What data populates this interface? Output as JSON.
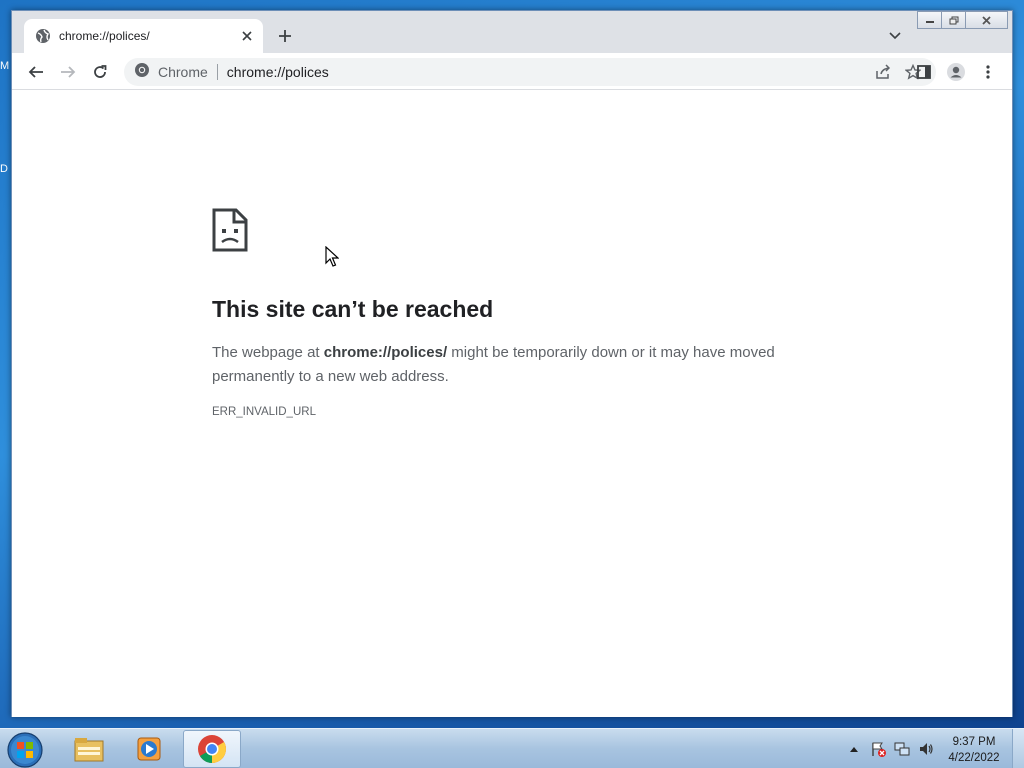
{
  "desktop": {
    "label_m": "M",
    "label_d": "D"
  },
  "browser": {
    "tab": {
      "title": "chrome://polices/"
    },
    "omnibox": {
      "chip_label": "Chrome",
      "url": "chrome://polices"
    },
    "window_controls": {
      "minimize": "minimize-icon",
      "restore": "restore-icon",
      "close": "close-icon"
    }
  },
  "error_page": {
    "title": "This site can’t be reached",
    "desc_prefix": "The webpage at ",
    "desc_url": "chrome://polices/",
    "desc_suffix": " might be temporarily down or it may have moved permanently to a new web address.",
    "code": "ERR_INVALID_URL"
  },
  "taskbar": {
    "apps": [
      "file-explorer",
      "media-player",
      "chrome"
    ],
    "clock": {
      "time": "9:37 PM",
      "date": "4/22/2022"
    }
  },
  "colors": {
    "tabbar": "#dee1e6",
    "omnibox": "#f1f3f4",
    "title_text": "#202124",
    "body_text": "#5f6368"
  }
}
